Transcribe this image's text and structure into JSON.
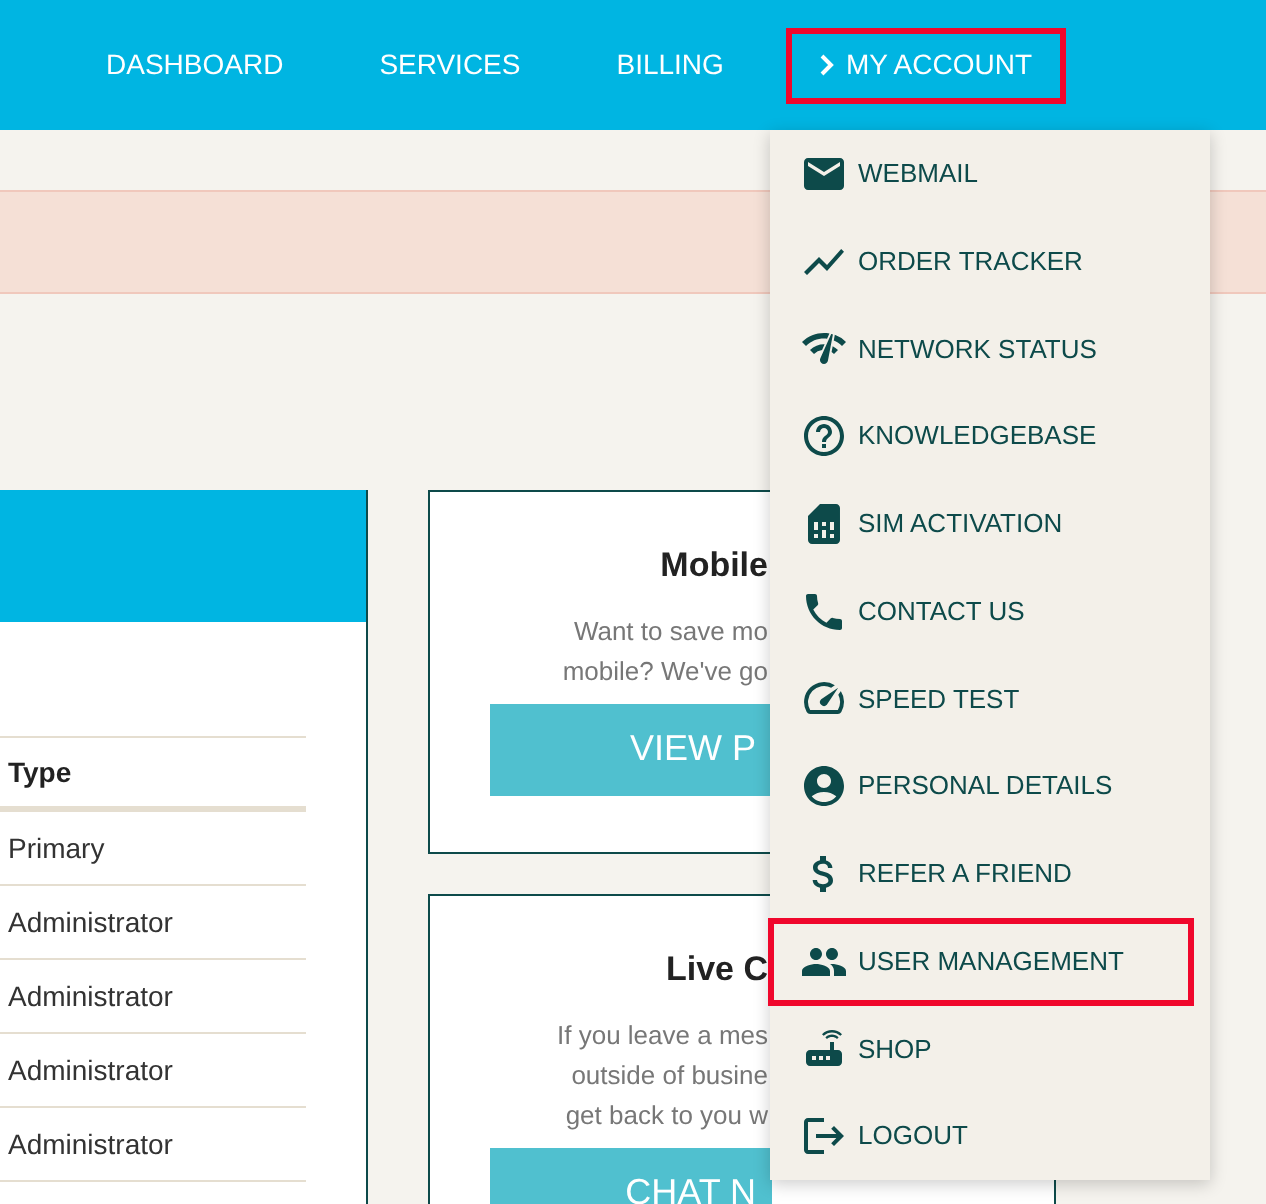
{
  "nav": {
    "items": [
      {
        "label": "DASHBOARD",
        "expanded": false,
        "highlighted": false
      },
      {
        "label": "SERVICES",
        "expanded": false,
        "highlighted": false
      },
      {
        "label": "BILLING",
        "expanded": false,
        "highlighted": false
      },
      {
        "label": "MY ACCOUNT",
        "expanded": true,
        "highlighted": true
      }
    ]
  },
  "users_table": {
    "columns": [
      "Type"
    ],
    "rows": [
      [
        "Primary"
      ],
      [
        "Administrator"
      ],
      [
        "Administrator"
      ],
      [
        "Administrator"
      ],
      [
        "Administrator"
      ]
    ]
  },
  "cards": [
    {
      "title": "Mobile",
      "text": [
        "Want to save mo",
        "mobile? We've go"
      ],
      "button": "VIEW P"
    },
    {
      "title": "Live C",
      "text": [
        "If you leave a mes",
        "outside of busine",
        "get back to you w"
      ],
      "button": "CHAT N"
    }
  ],
  "account_menu": {
    "items": [
      {
        "label": "WEBMAIL",
        "highlighted": false
      },
      {
        "label": "ORDER TRACKER",
        "highlighted": false
      },
      {
        "label": "NETWORK STATUS",
        "highlighted": false
      },
      {
        "label": "KNOWLEDGEBASE",
        "highlighted": false
      },
      {
        "label": "SIM ACTIVATION",
        "highlighted": false
      },
      {
        "label": "CONTACT US",
        "highlighted": false
      },
      {
        "label": "SPEED TEST",
        "highlighted": false
      },
      {
        "label": "PERSONAL DETAILS",
        "highlighted": false
      },
      {
        "label": "REFER A FRIEND",
        "highlighted": false
      },
      {
        "label": "USER MANAGEMENT",
        "highlighted": true
      },
      {
        "label": "SHOP",
        "highlighted": false
      },
      {
        "label": "LOGOUT",
        "highlighted": false
      }
    ]
  }
}
